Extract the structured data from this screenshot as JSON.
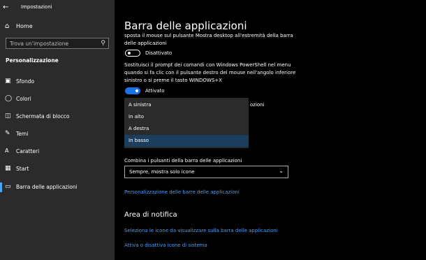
{
  "window": {
    "title": "Impostazioni",
    "back_icon": "back-arrow-icon"
  },
  "sidebar": {
    "home_label": "Home",
    "search_placeholder": "Trova un'impostazione",
    "section_title": "Personalizzazione",
    "items": [
      {
        "label": "Sfondo",
        "icon": "picture-icon"
      },
      {
        "label": "Colori",
        "icon": "palette-icon"
      },
      {
        "label": "Schermata di blocco",
        "icon": "lockscreen-icon"
      },
      {
        "label": "Temi",
        "icon": "brush-icon"
      },
      {
        "label": "Caratteri",
        "icon": "font-icon"
      },
      {
        "label": "Start",
        "icon": "start-icon"
      },
      {
        "label": "Barra delle applicazioni",
        "icon": "taskbar-icon",
        "selected": true
      }
    ],
    "accent_color": "#4aa3f5"
  },
  "main": {
    "title": "Barra delle applicazioni",
    "peek": {
      "line1": "sposta il mouse sul pulsante Mostra desktop all'estremità della barra",
      "line2": "delle applicazioni",
      "toggle_state": "off",
      "toggle_label": "Disattivato"
    },
    "powershell": {
      "line1": "Sostituisci il prompt dei comandi con Windows PowerShell nel menu",
      "line2": "quando si fa clic con il pulsante destro del mouse nell'angolo inferiore",
      "line3": "sinistro o si preme il tasto WINDOWS+X",
      "toggle_state": "on",
      "toggle_label": "Attivato"
    },
    "obscured_text_fragment": "ozioni",
    "position_dropdown": {
      "options": [
        "A sinistra",
        "In alto",
        "A destra",
        "In basso"
      ],
      "selected": "In basso"
    },
    "combine": {
      "label": "Combina i pulsanti della barra delle applicazioni",
      "value": "Sempre, mostra solo icone"
    },
    "customize_link": "Personalizzazione delle barre delle applicazioni",
    "notification": {
      "title": "Area di notifica",
      "link1": "Seleziona le icone da visualizzare sulla barra delle applicazioni",
      "link2": "Attiva o disattiva icone di sistema"
    },
    "toggle_on_color": "#1a73e8",
    "link_color": "#4a9ff5"
  }
}
